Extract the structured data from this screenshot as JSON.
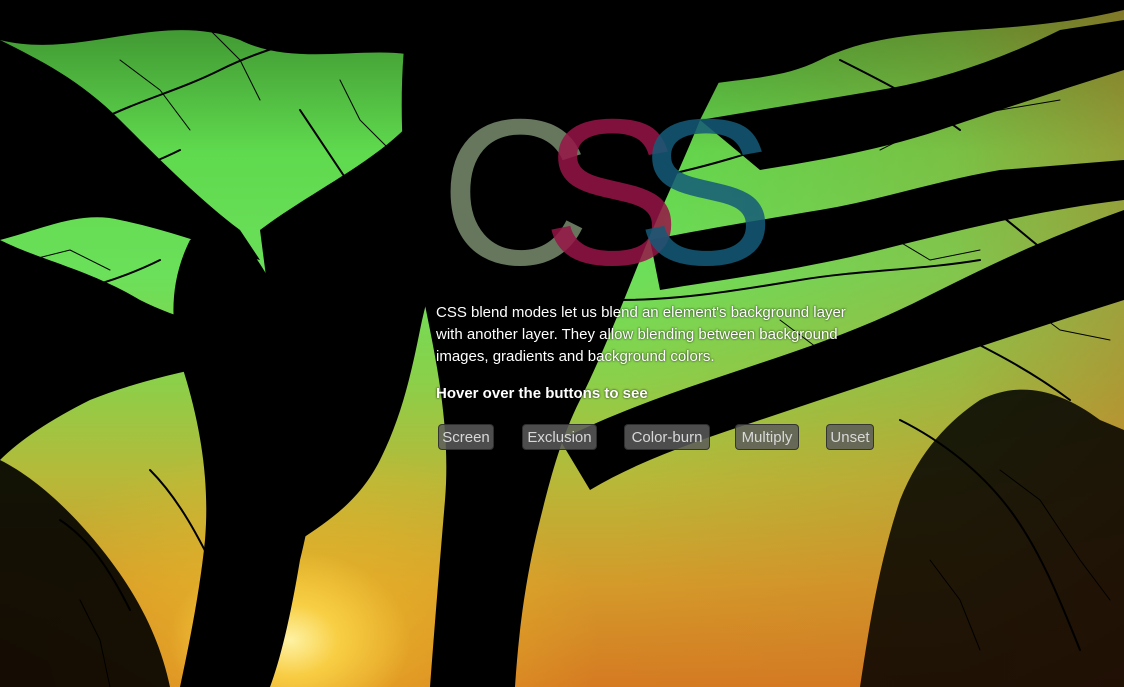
{
  "hero": {
    "logo_letters": [
      "C",
      "S",
      "S"
    ],
    "logo_colors": [
      "#788c6e",
      "#961446",
      "#145a78"
    ]
  },
  "description": "CSS blend modes let us blend an element's background layer with another layer. They allow blending between background images, gradients and background colors.",
  "hover_hint": "Hover over the buttons to see",
  "buttons": [
    {
      "label": "Screen"
    },
    {
      "label": "Exclusion"
    },
    {
      "label": "Color-burn"
    },
    {
      "label": "Multiply"
    },
    {
      "label": "Unset"
    }
  ],
  "background": {
    "image": "tree-silhouette-against-sunset",
    "sky_color_top": "#5fd94e",
    "sky_color_bottom": "#d57a22"
  }
}
